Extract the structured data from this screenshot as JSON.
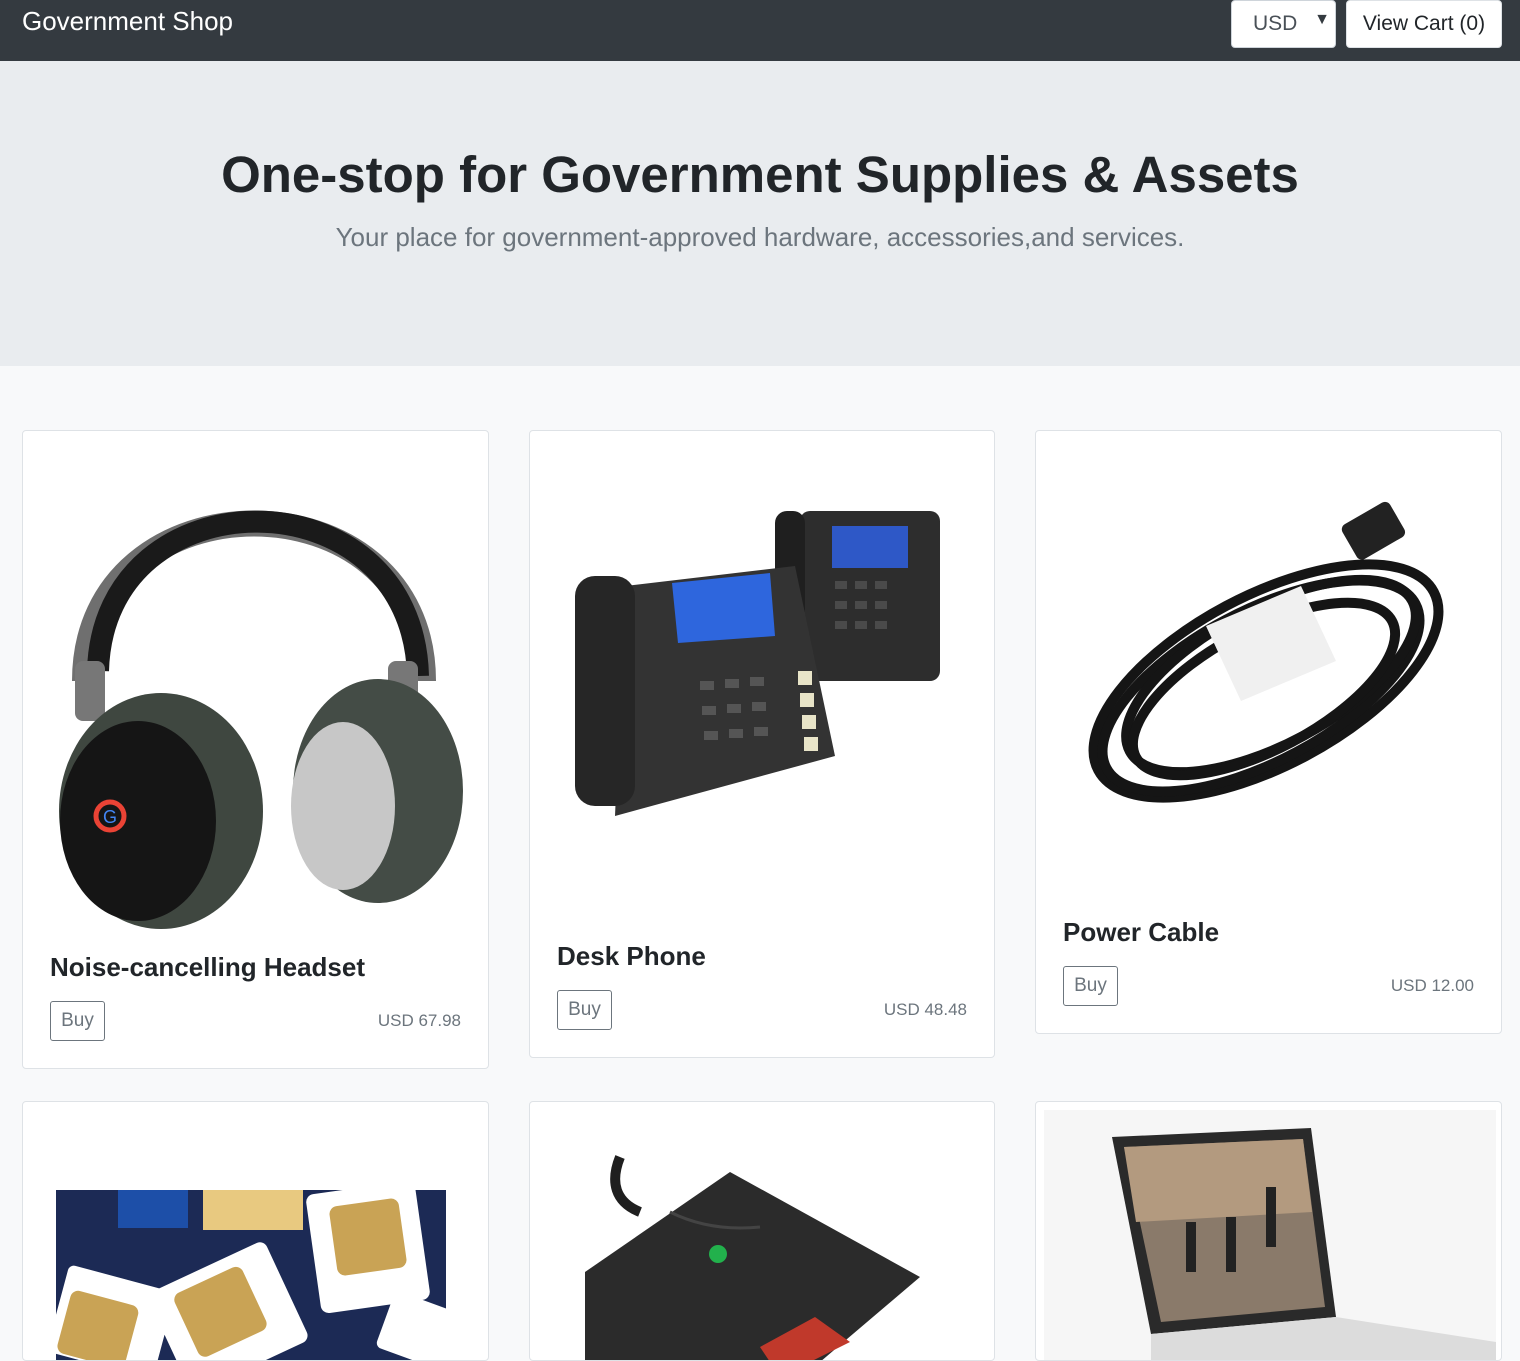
{
  "nav": {
    "brand": "Government Shop",
    "currency": "USD",
    "cart": "View Cart (0)"
  },
  "hero": {
    "title": "One-stop for Government Supplies & Assets",
    "subtitle": "Your place for government-approved hardware, accessories,and services."
  },
  "products": [
    {
      "name": "Noise-cancelling Headset",
      "buy": "Buy",
      "price": "USD 67.98",
      "icon": "headset-icon"
    },
    {
      "name": "Desk Phone",
      "buy": "Buy",
      "price": "USD 48.48",
      "icon": "desk-phone-icon"
    },
    {
      "name": "Power Cable",
      "buy": "Buy",
      "price": "USD 12.00",
      "icon": "power-cable-icon"
    },
    {
      "icon": "sim-cards-icon"
    },
    {
      "icon": "card-reader-icon"
    },
    {
      "icon": "laptop-icon"
    }
  ]
}
